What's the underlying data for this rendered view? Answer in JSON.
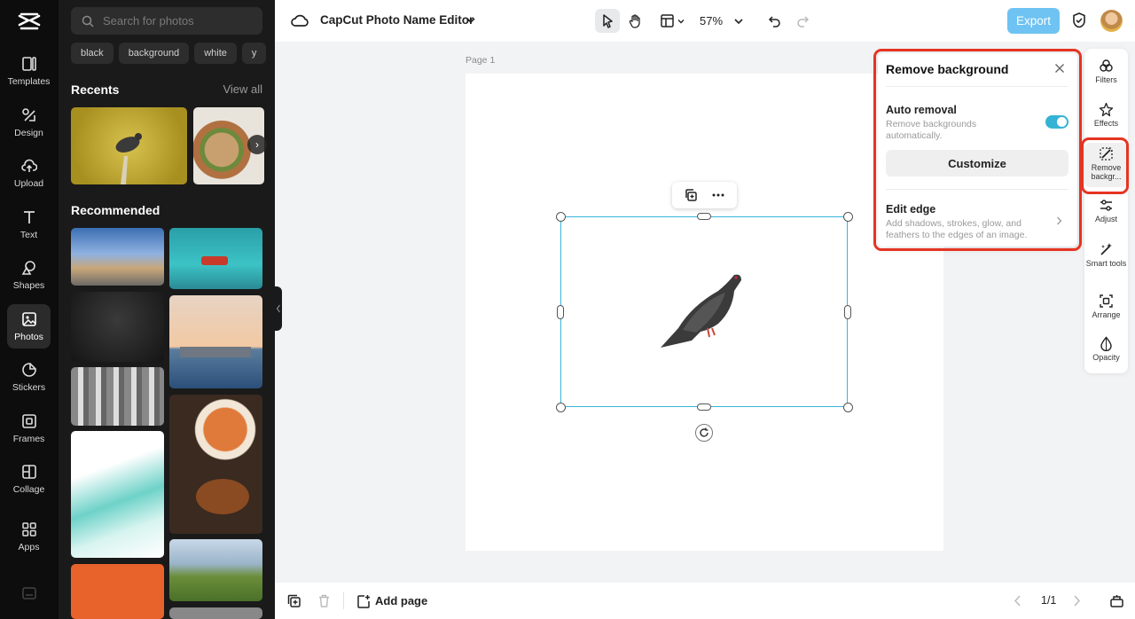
{
  "app": {
    "title": "CapCut Photo Name Editor",
    "zoom": "57%",
    "export_label": "Export",
    "page_label": "Page 1"
  },
  "rail": {
    "items": [
      {
        "label": "Templates",
        "icon": "templates-icon"
      },
      {
        "label": "Design",
        "icon": "design-icon"
      },
      {
        "label": "Upload",
        "icon": "upload-icon"
      },
      {
        "label": "Text",
        "icon": "text-icon"
      },
      {
        "label": "Shapes",
        "icon": "shapes-icon"
      },
      {
        "label": "Photos",
        "icon": "photos-icon",
        "active": true
      },
      {
        "label": "Stickers",
        "icon": "stickers-icon"
      },
      {
        "label": "Frames",
        "icon": "frames-icon"
      },
      {
        "label": "Collage",
        "icon": "collage-icon"
      },
      {
        "label": "Apps",
        "icon": "apps-icon"
      }
    ]
  },
  "photos": {
    "search_placeholder": "Search for photos",
    "chips": [
      "black",
      "background",
      "white",
      "y"
    ],
    "recents_title": "Recents",
    "view_all": "View all",
    "recommended_title": "Recommended"
  },
  "remove_bg": {
    "title": "Remove background",
    "auto_title": "Auto removal",
    "auto_desc": "Remove backgrounds automatically.",
    "auto_enabled": true,
    "customize_label": "Customize",
    "edge_title": "Edit edge",
    "edge_desc": "Add shadows, strokes, glow, and feathers to the edges of an image."
  },
  "right_tools": [
    {
      "label": "Filters",
      "icon": "filters-icon"
    },
    {
      "label": "Effects",
      "icon": "effects-icon"
    },
    {
      "label": "Remove backgr...",
      "icon": "remove-background-icon",
      "active": true
    },
    {
      "label": "Adjust",
      "icon": "adjust-icon"
    },
    {
      "label": "Smart tools",
      "icon": "smart-tools-icon"
    },
    {
      "label": "Arrange",
      "icon": "arrange-icon"
    },
    {
      "label": "Opacity",
      "icon": "opacity-icon"
    }
  ],
  "bottom": {
    "add_page_label": "Add page",
    "pager": "1/1"
  },
  "colors": {
    "accent": "#3ab4d8",
    "export": "#6ec3f2",
    "highlight": "#e53422"
  }
}
